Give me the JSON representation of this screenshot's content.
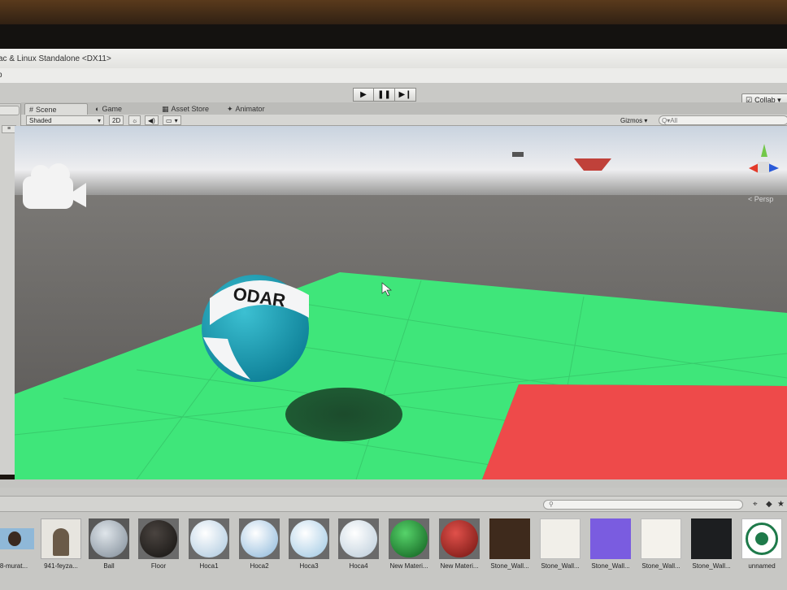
{
  "window": {
    "title": "ac & Linux Standalone <DX11>",
    "menu_fragment": "p"
  },
  "toolbar": {
    "play": "▶",
    "pause": "❚❚",
    "step": "▶❙",
    "collab_label": "Collab ▾"
  },
  "tabs": [
    {
      "label": "Scene",
      "icon": "#"
    },
    {
      "label": "Game",
      "icon": "◐"
    },
    {
      "label": "Asset Store",
      "icon": "▦"
    },
    {
      "label": "Animator",
      "icon": "✦"
    }
  ],
  "scene_bar": {
    "shading": "Shaded",
    "mode_2d": "2D",
    "light": "☼",
    "audio": "◀)",
    "fx": "▭",
    "gizmos": "Gizmos ▾",
    "search_placeholder": "Q▾All"
  },
  "gizmo": {
    "persp_label": "< Persp"
  },
  "ball": {
    "text": "ODAR"
  },
  "colors": {
    "floor": "#3fe67a",
    "red_plane": "#ee4a4a",
    "ball_blue": "#1a9db4"
  },
  "project": {
    "search_placeholder": "",
    "assets": [
      {
        "label": "8-murat...",
        "kind": "photo"
      },
      {
        "label": "941-feyza...",
        "kind": "photo"
      },
      {
        "label": "Ball",
        "kind": "ball-logo"
      },
      {
        "label": "Floor",
        "kind": "ball-dark"
      },
      {
        "label": "Hoca1",
        "kind": "ball-light"
      },
      {
        "label": "Hoca2",
        "kind": "ball-light"
      },
      {
        "label": "Hoca3",
        "kind": "ball-light"
      },
      {
        "label": "Hoca4",
        "kind": "ball-light"
      },
      {
        "label": "New Materi...",
        "kind": "ball-green"
      },
      {
        "label": "New Materi...",
        "kind": "ball-red"
      },
      {
        "label": "Stone_Wall...",
        "kind": "tex-brown"
      },
      {
        "label": "Stone_Wall...",
        "kind": "tex-white"
      },
      {
        "label": "Stone_Wall...",
        "kind": "tex-purple"
      },
      {
        "label": "Stone_Wall...",
        "kind": "tex-offwhite"
      },
      {
        "label": "Stone_Wall...",
        "kind": "tex-black"
      },
      {
        "label": "unnamed",
        "kind": "logo"
      }
    ]
  }
}
